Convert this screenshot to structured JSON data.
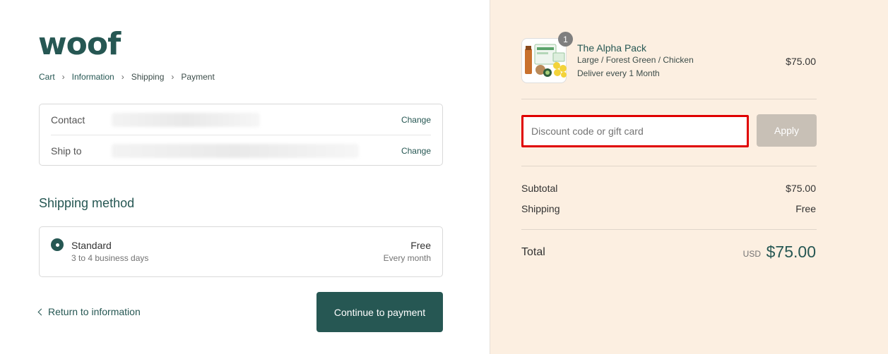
{
  "brand": {
    "logo_text": "woof"
  },
  "breadcrumb": [
    {
      "label": "Cart"
    },
    {
      "label": "Information"
    },
    {
      "label": "Shipping"
    },
    {
      "label": "Payment"
    }
  ],
  "review": {
    "contact_label": "Contact",
    "ship_to_label": "Ship to",
    "change_label": "Change"
  },
  "shipping_method": {
    "title": "Shipping method",
    "option_name": "Standard",
    "option_detail": "3 to 4 business days",
    "option_price": "Free",
    "option_frequency": "Every month"
  },
  "actions": {
    "return_label": "Return to information",
    "continue_label": "Continue to payment"
  },
  "order": {
    "product_name": "The Alpha Pack",
    "product_variant": "Large / Forest Green / Chicken",
    "product_delivery": "Deliver every 1 Month",
    "product_price": "$75.00",
    "quantity_badge": "1"
  },
  "discount": {
    "placeholder": "Discount code or gift card",
    "apply_label": "Apply"
  },
  "summary": {
    "subtotal_label": "Subtotal",
    "subtotal_value": "$75.00",
    "shipping_label": "Shipping",
    "shipping_value": "Free",
    "total_label": "Total",
    "currency": "USD",
    "total_value": "$75.00"
  },
  "colors": {
    "brand": "#265753",
    "sidebar_bg": "#fcefe1",
    "highlight": "#e00000"
  }
}
